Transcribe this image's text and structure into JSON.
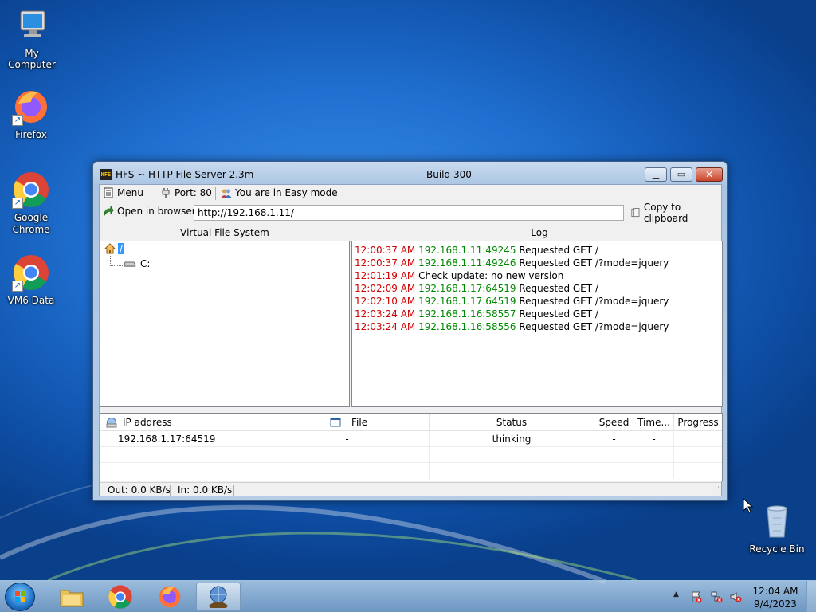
{
  "desktop": {
    "icons": [
      {
        "label": "My Computer",
        "icon": "computer-icon"
      },
      {
        "label": "Firefox",
        "icon": "firefox-icon"
      },
      {
        "label": "Google\nChrome",
        "icon": "chrome-icon"
      },
      {
        "label": "VM6 Data",
        "icon": "chrome-icon"
      },
      {
        "label": "Recycle Bin",
        "icon": "recycle-bin-icon"
      }
    ]
  },
  "window": {
    "title": "HFS ~ HTTP File Server 2.3m",
    "build": "Build 300",
    "toolbar": {
      "menu_label": "Menu",
      "port_label": "Port: 80",
      "mode_label": "You are in Easy mode"
    },
    "browser_bar": {
      "open_label": "Open in browser",
      "url_value": "http://192.168.1.11/",
      "copy_label": "Copy to clipboard"
    },
    "vfs": {
      "header": "Virtual File System",
      "root_label": "/",
      "child_label": "C:"
    },
    "log": {
      "header": "Log",
      "lines": [
        {
          "time": "12:00:37 AM",
          "ip": "192.168.1.11:49245",
          "msg": "Requested GET /"
        },
        {
          "time": "12:00:37 AM",
          "ip": "192.168.1.11:49246",
          "msg": "Requested GET /?mode=jquery"
        },
        {
          "time": "12:01:19 AM",
          "ip": "",
          "msg": "Check update: no new version"
        },
        {
          "time": "12:02:09 AM",
          "ip": "192.168.1.17:64519",
          "msg": "Requested GET /"
        },
        {
          "time": "12:02:10 AM",
          "ip": "192.168.1.17:64519",
          "msg": "Requested GET /?mode=jquery"
        },
        {
          "time": "12:03:24 AM",
          "ip": "192.168.1.16:58557",
          "msg": "Requested GET /"
        },
        {
          "time": "12:03:24 AM",
          "ip": "192.168.1.16:58556",
          "msg": "Requested GET /?mode=jquery"
        }
      ]
    },
    "connections": {
      "columns": [
        "IP address",
        "File",
        "Status",
        "Speed",
        "Time...",
        "Progress"
      ],
      "rows": [
        {
          "ip": "192.168.1.17:64519",
          "file": "-",
          "status": "thinking",
          "speed": "-",
          "time": "-",
          "progress": ""
        }
      ]
    },
    "statusbar": {
      "out": "Out: 0.0 KB/s",
      "in": "In: 0.0 KB/s"
    }
  },
  "taskbar": {
    "apps": [
      "explorer-icon",
      "chrome-icon",
      "firefox-icon",
      "hfs-icon"
    ],
    "clock_time": "12:04 AM",
    "clock_date": "9/4/2023"
  },
  "colors": {
    "log_time": "#d00000",
    "log_ip": "#008a00"
  }
}
